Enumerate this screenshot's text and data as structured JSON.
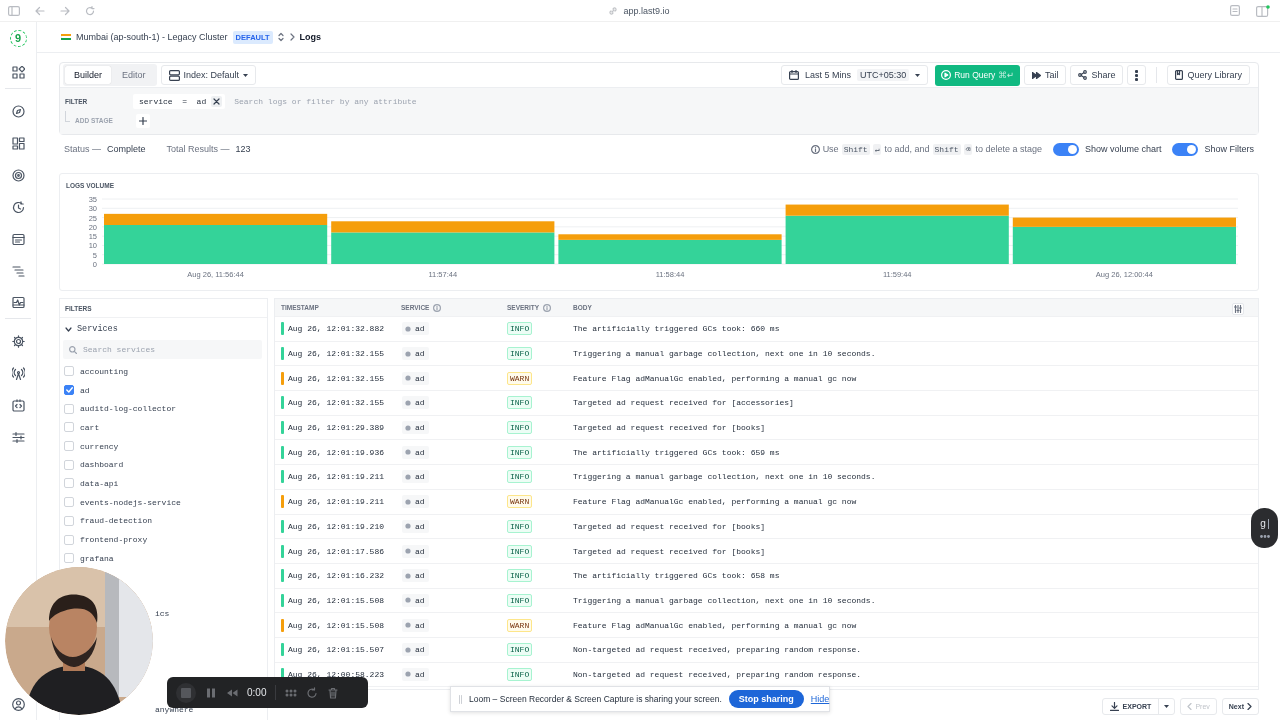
{
  "browser": {
    "url": "app.last9.io"
  },
  "app": {
    "logo": "9"
  },
  "breadcrumb": {
    "cluster": "Mumbai (ap-south-1) - Legacy Cluster",
    "badge": "DEFAULT",
    "page": "Logs"
  },
  "query": {
    "modes": [
      {
        "label": "Builder",
        "selected": true
      },
      {
        "label": "Editor",
        "selected": false
      }
    ],
    "index": "Index: Default",
    "time_range": "Last 5 Mins",
    "timezone": "UTC+05:30",
    "run": "Run Query",
    "run_shortcut": "⌘↵",
    "actions": [
      {
        "label": "Tail",
        "kind": "tail"
      },
      {
        "label": "Share",
        "kind": "share"
      }
    ],
    "library": "Query Library",
    "filter": {
      "label": "FILTER",
      "field": "service",
      "op": "=",
      "value": "ad",
      "placeholder": "Search logs or filter by any attribute"
    },
    "add_stage": "ADD STAGE"
  },
  "status": {
    "status_label": "Status —",
    "status": "Complete",
    "total_label": "Total Results —",
    "total": "123"
  },
  "hint": [
    {
      "kind": "text",
      "text": "Use"
    },
    {
      "kind": "key",
      "text": "Shift"
    },
    {
      "kind": "key",
      "text": "↵"
    },
    {
      "kind": "text",
      "text": "to add, and"
    },
    {
      "kind": "key",
      "text": "Shift"
    },
    {
      "kind": "key",
      "text": "⌫"
    },
    {
      "kind": "text",
      "text": "to delete a stage"
    }
  ],
  "toggles": [
    {
      "label": "Show volume chart",
      "on": true
    },
    {
      "label": "Show Filters",
      "on": true
    }
  ],
  "volume": {
    "title": "LOGS VOLUME",
    "chart_data": {
      "type": "bar",
      "stacked": true,
      "categories": [
        "Aug 26, 11:56:44",
        "11:57:44",
        "11:58:44",
        "11:59:44",
        "Aug 26, 12:00:44"
      ],
      "yticks": [
        0,
        5,
        10,
        15,
        20,
        25,
        30,
        35
      ],
      "ylim": [
        0,
        35
      ],
      "grid": true,
      "series": [
        {
          "color": "#34d399",
          "values": [
            21,
            17,
            13,
            26,
            20
          ]
        },
        {
          "color": "#f59e0b",
          "values": [
            6,
            6,
            3,
            6,
            5
          ]
        }
      ]
    }
  },
  "filters": {
    "title": "FILTERS",
    "group": "Services",
    "expanded": true,
    "search_placeholder": "Search services",
    "items": [
      {
        "label": "accounting",
        "checked": false
      },
      {
        "label": "ad",
        "checked": true
      },
      {
        "label": "auditd-log-collector",
        "checked": false
      },
      {
        "label": "cart",
        "checked": false
      },
      {
        "label": "currency",
        "checked": false
      },
      {
        "label": "dashboard",
        "checked": false
      },
      {
        "label": "data-api",
        "checked": false
      },
      {
        "label": "events-nodejs-service",
        "checked": false
      },
      {
        "label": "fraud-detection",
        "checked": false
      },
      {
        "label": "frontend-proxy",
        "checked": false
      },
      {
        "label": "grafana",
        "checked": false
      }
    ],
    "fragment": "ics",
    "footer_fragment": "anywhere"
  },
  "table": {
    "columns": [
      {
        "label": "TIMESTAMP",
        "info": false
      },
      {
        "label": "SERVICE",
        "info": true
      },
      {
        "label": "SEVERITY",
        "info": true
      },
      {
        "label": "BODY",
        "info": false
      }
    ],
    "rows": [
      {
        "timestamp": "Aug 26, 12:01:32.882",
        "service": "ad",
        "severity": "INFO",
        "kind": "info",
        "body": "The artificially triggered GCs took: 660 ms"
      },
      {
        "timestamp": "Aug 26, 12:01:32.155",
        "service": "ad",
        "severity": "INFO",
        "kind": "info",
        "body": "Triggering a manual garbage collection, next one in 10 seconds."
      },
      {
        "timestamp": "Aug 26, 12:01:32.155",
        "service": "ad",
        "severity": "WARN",
        "kind": "warn",
        "body": "Feature Flag adManualGc enabled, performing a manual gc now"
      },
      {
        "timestamp": "Aug 26, 12:01:32.155",
        "service": "ad",
        "severity": "INFO",
        "kind": "info",
        "body": "Targeted ad request received for [accessories]"
      },
      {
        "timestamp": "Aug 26, 12:01:29.389",
        "service": "ad",
        "severity": "INFO",
        "kind": "info",
        "body": "Targeted ad request received for [books]"
      },
      {
        "timestamp": "Aug 26, 12:01:19.936",
        "service": "ad",
        "severity": "INFO",
        "kind": "info",
        "body": "The artificially triggered GCs took: 659 ms"
      },
      {
        "timestamp": "Aug 26, 12:01:19.211",
        "service": "ad",
        "severity": "INFO",
        "kind": "info",
        "body": "Triggering a manual garbage collection, next one in 10 seconds."
      },
      {
        "timestamp": "Aug 26, 12:01:19.211",
        "service": "ad",
        "severity": "WARN",
        "kind": "warn",
        "body": "Feature Flag adManualGc enabled, performing a manual gc now"
      },
      {
        "timestamp": "Aug 26, 12:01:19.210",
        "service": "ad",
        "severity": "INFO",
        "kind": "info",
        "body": "Targeted ad request received for [books]"
      },
      {
        "timestamp": "Aug 26, 12:01:17.586",
        "service": "ad",
        "severity": "INFO",
        "kind": "info",
        "body": "Targeted ad request received for [books]"
      },
      {
        "timestamp": "Aug 26, 12:01:16.232",
        "service": "ad",
        "severity": "INFO",
        "kind": "info",
        "body": "The artificially triggered GCs took: 658 ms"
      },
      {
        "timestamp": "Aug 26, 12:01:15.508",
        "service": "ad",
        "severity": "INFO",
        "kind": "info",
        "body": "Triggering a manual garbage collection, next one in 10 seconds."
      },
      {
        "timestamp": "Aug 26, 12:01:15.508",
        "service": "ad",
        "severity": "WARN",
        "kind": "warn",
        "body": "Feature Flag adManualGc enabled, performing a manual gc now"
      },
      {
        "timestamp": "Aug 26, 12:01:15.507",
        "service": "ad",
        "severity": "INFO",
        "kind": "info",
        "body": "Non-targeted ad request received, preparing random response."
      },
      {
        "timestamp": "Aug 26, 12:00:58.223",
        "service": "ad",
        "severity": "INFO",
        "kind": "info",
        "body": "Non-targeted ad request received, preparing random response."
      }
    ]
  },
  "footer": {
    "export": "EXPORT",
    "prev": "Prev",
    "prev_disabled": true,
    "next": "Next"
  },
  "recorder": {
    "time": "0:00"
  },
  "loom": {
    "message": "Loom – Screen Recorder & Screen Capture is sharing your screen.",
    "stop": "Stop sharing",
    "hide": "Hide"
  },
  "widget": {
    "letter": "g"
  }
}
